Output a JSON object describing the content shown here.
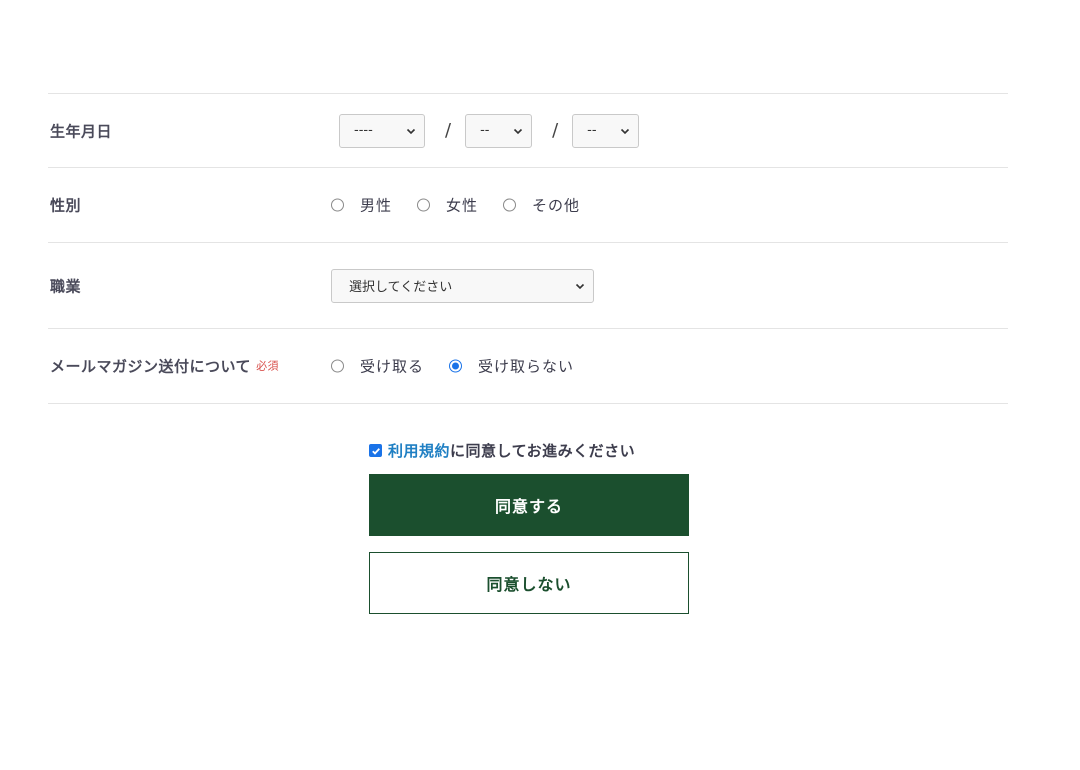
{
  "form": {
    "birthdate": {
      "label": "生年月日",
      "year_value": "----",
      "month_value": "--",
      "day_value": "--",
      "separator": "/"
    },
    "gender": {
      "label": "性別",
      "options": [
        "男性",
        "女性",
        "その他"
      ],
      "selected": null
    },
    "occupation": {
      "label": "職業",
      "value": "選択してください"
    },
    "newsletter": {
      "label": "メールマガジン送付について",
      "required_badge": "必須",
      "options": [
        "受け取る",
        "受け取らない"
      ],
      "selected": "受け取らない"
    }
  },
  "agreement": {
    "checked": true,
    "terms_link": "利用規約",
    "text": "に同意してお進みください"
  },
  "buttons": {
    "agree_label": "同意する",
    "disagree_label": "同意しない"
  },
  "colors": {
    "primary_green": "#1b4f2e",
    "link_blue": "#1f7fc3",
    "required_red": "#d9534f",
    "radio_checked": "#1a73e8"
  }
}
